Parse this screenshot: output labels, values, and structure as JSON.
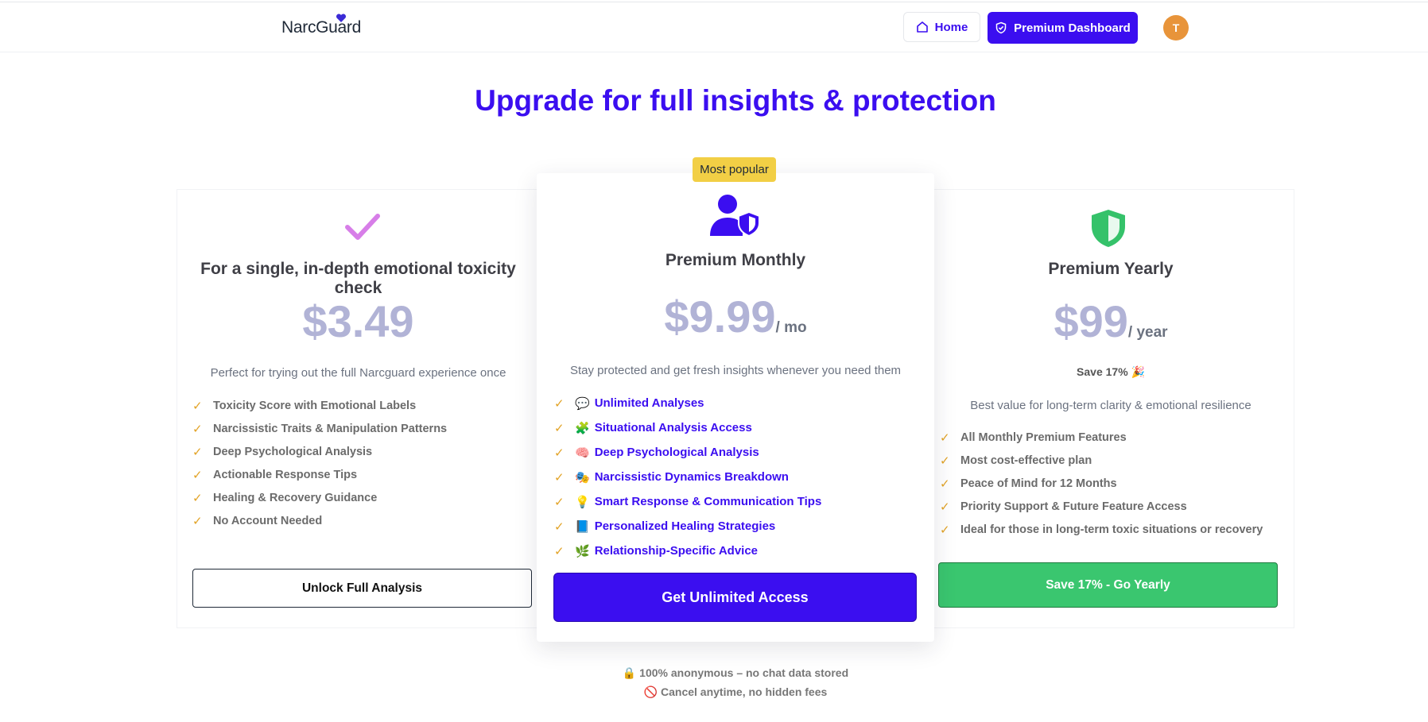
{
  "navbar": {
    "logo": "NarcGuard",
    "home_label": "Home",
    "premium_label": "Premium Dashboard",
    "avatar_initial": "T"
  },
  "page": {
    "title": "Upgrade for full insights & protection"
  },
  "plans": {
    "single": {
      "title": "For a single, in-depth emotional toxicity check",
      "price": "$3.49",
      "description": "Perfect for trying out the full Narcguard experience once",
      "features": [
        "Toxicity Score with Emotional Labels",
        "Narcissistic Traits & Manipulation Patterns",
        "Deep Psychological Analysis",
        "Actionable Response Tips",
        "Healing & Recovery Guidance",
        "No Account Needed"
      ],
      "button": "Unlock Full Analysis"
    },
    "monthly": {
      "badge": "Most popular",
      "title": "Premium Monthly",
      "price": "$9.99",
      "period": "/ mo",
      "description": "Stay protected and get fresh insights whenever you need them",
      "features": [
        {
          "emoji": "💬",
          "label": "Unlimited Analyses"
        },
        {
          "emoji": "🧩",
          "label": "Situational Analysis Access"
        },
        {
          "emoji": "🧠",
          "label": "Deep Psychological Analysis"
        },
        {
          "emoji": "🎭",
          "label": "Narcissistic Dynamics Breakdown"
        },
        {
          "emoji": "💡",
          "label": "Smart Response & Communication Tips"
        },
        {
          "emoji": "📘",
          "label": "Personalized Healing Strategies"
        },
        {
          "emoji": "🌿",
          "label": "Relationship-Specific Advice"
        }
      ],
      "button": "Get Unlimited Access"
    },
    "yearly": {
      "title": "Premium Yearly",
      "price": "$99",
      "period": "/ year",
      "savings": "Save 17% 🎉",
      "description": "Best value for long-term clarity & emotional resilience",
      "features": [
        "All Monthly Premium Features",
        "Most cost-effective plan",
        "Peace of Mind for 12 Months",
        "Priority Support & Future Feature Access",
        "Ideal for those in long-term toxic situations or recovery"
      ],
      "button": "Save 17% - Go Yearly"
    }
  },
  "footer": {
    "line1": "🔒 100% anonymous – no chat data stored",
    "line2": "🚫 Cancel anytime, no hidden fees"
  },
  "colors": {
    "brand": "#3b0ef0",
    "badge": "#f2cf45",
    "green": "#3ac66f",
    "price": "#b1b3d6",
    "check": "#e2a326",
    "avatar": "#e8943a"
  }
}
